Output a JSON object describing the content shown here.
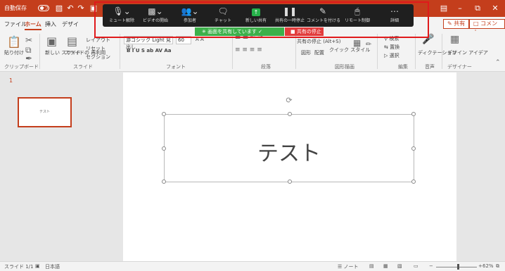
{
  "titlebar": {
    "autosave": "自動保存",
    "autosave_toggle": "オフ",
    "share": "共有",
    "comment": "コメント"
  },
  "ribbon_tabs": [
    "ファイル",
    "ホーム",
    "挿入",
    "デザイ"
  ],
  "ribbon": {
    "paste": "貼り付け",
    "new_slide": "新しい\nスライド",
    "reuse_slide": "スライドの\n再利用",
    "layout": "レイアウト",
    "reset": "リセット",
    "section": "セクション",
    "font_name": "游ゴシック Light 見出し",
    "font_size": "60",
    "font_style_buttons": "B I U S ab AV Aa",
    "stop_share_tooltip": "共有の停止 (Alt+S)",
    "shapes": "図形",
    "arrange": "配置",
    "quick_styles": "クイック\nスタイル",
    "find": "検索",
    "replace": "置換",
    "select": "選択",
    "dictate": "ディクテーション",
    "designer": "デザイン\nアイデア",
    "groups": {
      "clipboard": "クリップボード",
      "slides": "スライド",
      "font": "フォント",
      "paragraph": "段落",
      "drawing": "図形描画",
      "editing": "編集",
      "voice": "音声",
      "designer": "デザイナー"
    }
  },
  "zoom_toolbar": {
    "items": [
      {
        "icon": "mute-icon",
        "label": "ミュート解除"
      },
      {
        "icon": "video-off-icon",
        "label": "ビデオの開始"
      },
      {
        "icon": "participants-icon",
        "label": "参加者"
      },
      {
        "icon": "chat-icon",
        "label": "チャット"
      },
      {
        "icon": "new-share-icon",
        "label": "新しい共有"
      },
      {
        "icon": "pause-share-icon",
        "label": "共有の一時停止"
      },
      {
        "icon": "annotate-icon",
        "label": "コメントを付ける"
      },
      {
        "icon": "remote-control-icon",
        "label": "リモート制御"
      },
      {
        "icon": "more-icon",
        "label": "詳細"
      }
    ],
    "sharing_banner": "画面を共有しています",
    "stop_share": "共有の停止"
  },
  "slides_pane": {
    "slide_number": "1",
    "thumb_text": "テスト"
  },
  "slide": {
    "title_text": "テスト"
  },
  "statusbar": {
    "slide_info": "スライド 1/1",
    "language": "日本語",
    "notes": "ノート",
    "zoom": "62%"
  }
}
